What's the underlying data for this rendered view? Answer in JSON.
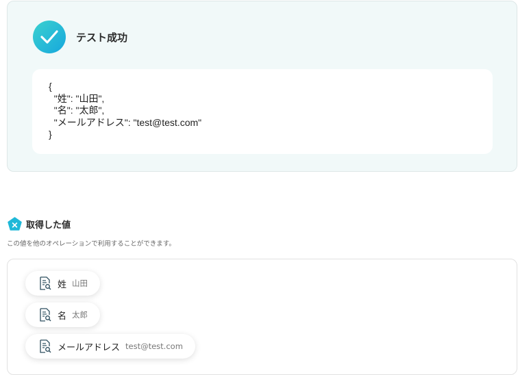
{
  "success": {
    "title": "テスト成功",
    "json_lines": [
      "{",
      "  \"姓\": \"山田\",",
      "  \"名\": \"太郎\",",
      "  \"メールアドレス\": \"test@test.com\"",
      "}"
    ]
  },
  "retrieved": {
    "title": "取得した値",
    "description": "この値を他のオペレーションで利用することができます。",
    "items": [
      {
        "label": "姓",
        "value": "山田"
      },
      {
        "label": "名",
        "value": "太郎"
      },
      {
        "label": "メールアドレス",
        "value": "test@test.com"
      }
    ]
  },
  "colors": {
    "accent": "#1fb8d8",
    "panel_bg": "#f1f9f9",
    "icon_stroke": "#2f4f5f"
  },
  "icons": {
    "success": "check-circle-icon",
    "section": "pentagon-x-icon",
    "item": "document-search-icon"
  }
}
